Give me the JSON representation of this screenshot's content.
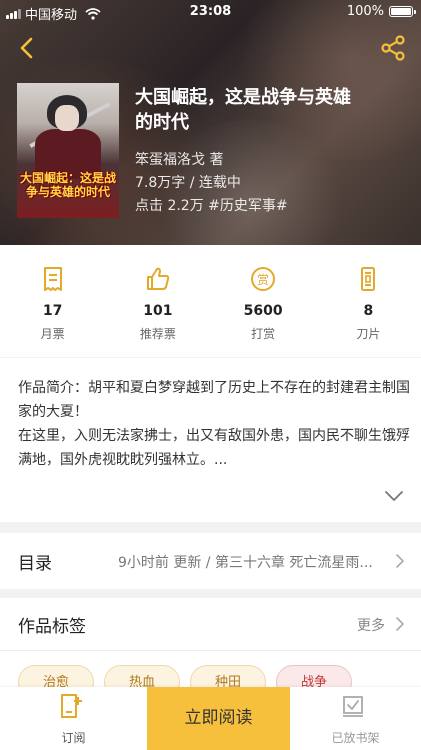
{
  "status_bar": {
    "carrier": "中国移动",
    "time": "23:08",
    "battery": "100%"
  },
  "book": {
    "title": "大国崛起，这是战争与英雄的时代",
    "cover_title": "大国崛起：这是战争与英雄的时代",
    "author": "笨蛋福洛戈 著",
    "words_status": "7.8万字 / 连载中",
    "clicks": "点击 2.2万",
    "genre_tag": "#历史军事#"
  },
  "stats": [
    {
      "icon": "monthly-ticket-icon",
      "value": "17",
      "label": "月票"
    },
    {
      "icon": "thumbs-up-icon",
      "value": "101",
      "label": "推荐票"
    },
    {
      "icon": "reward-coin-icon",
      "value": "5600",
      "label": "打赏"
    },
    {
      "icon": "blade-icon",
      "value": "8",
      "label": "刀片"
    }
  ],
  "intro": {
    "line1": "作品简介：胡平和夏白梦穿越到了历史上不存在的封建君主制国家的大夏！",
    "line2": "在这里，入则无法家拂士，出又有敌国外患，国内民不聊生饿殍满地，国外虎视眈眈列强林立。..."
  },
  "catalog": {
    "title": "目录",
    "update": "9小时前 更新 / 第三十六章 死亡流星雨..."
  },
  "tags": {
    "title": "作品标签",
    "more": "更多",
    "items": [
      "治愈",
      "热血",
      "种田",
      "战争"
    ]
  },
  "bottom_bar": {
    "subscribe": "订阅",
    "read_now": "立即阅读",
    "shelf": "已放书架"
  },
  "colors": {
    "accent": "#f6c03d",
    "icon_gold": "#e3a92a"
  }
}
